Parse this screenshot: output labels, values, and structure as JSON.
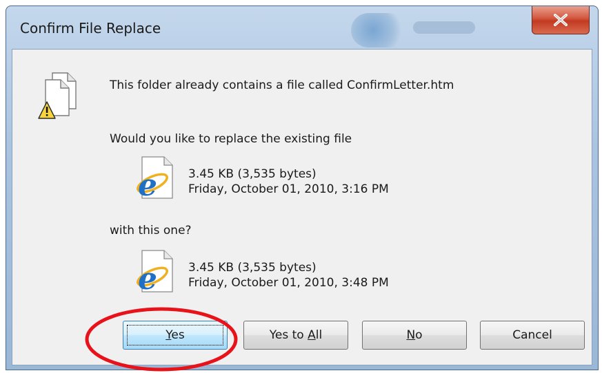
{
  "window": {
    "title": "Confirm File Replace"
  },
  "dialog": {
    "message": "This folder already contains a file called ConfirmLetter.htm",
    "question": "Would you like to replace the existing file",
    "existing_file": {
      "size": "3.45 KB (3,535 bytes)",
      "date": "Friday, October 01, 2010, 3:16 PM"
    },
    "with_text": "with this one?",
    "new_file": {
      "size": "3.45 KB (3,535 bytes)",
      "date": "Friday, October 01, 2010, 3:48 PM"
    }
  },
  "buttons": {
    "yes": {
      "pre": "",
      "accel": "Y",
      "post": "es"
    },
    "yes_to_all": {
      "pre": "Yes to ",
      "accel": "A",
      "post": "ll"
    },
    "no": {
      "pre": "",
      "accel": "N",
      "post": "o"
    },
    "cancel": "Cancel"
  },
  "icons": {
    "warning": "file-warning-icon",
    "file": "internet-explorer-file-icon",
    "close": "close-icon"
  },
  "colors": {
    "highlight": "#e8121a",
    "close_button": "#c9452c",
    "title_bar": "#b3cbe6",
    "dialog_background": "#f0f0f0"
  }
}
